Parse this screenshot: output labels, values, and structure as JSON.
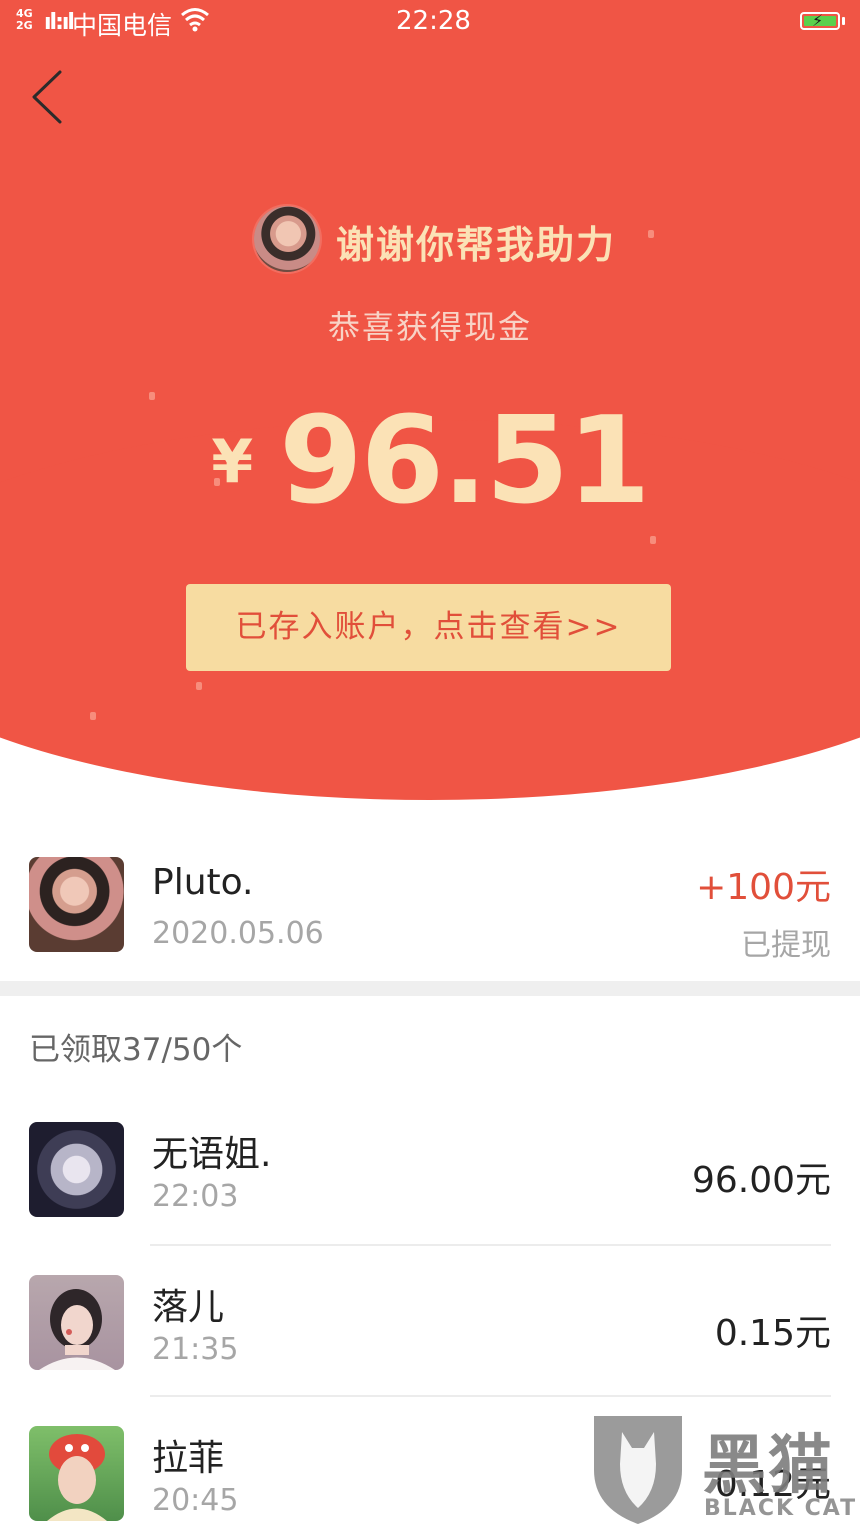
{
  "status_bar": {
    "network": "4G\n2G",
    "signal": "ıl ıl",
    "carrier": "中国电信",
    "time": "22:28"
  },
  "header": {
    "helper_title": "谢谢你帮我助力",
    "subtitle": "恭喜获得现金",
    "currency": "¥",
    "amount": "96.51",
    "cta_label": "已存入账户，点击查看>>"
  },
  "me": {
    "name": "Pluto.",
    "date": "2020.05.06",
    "amount": "+100元",
    "status": "已提现"
  },
  "claimed_summary": "已领取37/50个",
  "records": [
    {
      "name": "无语姐.",
      "time": "22:03",
      "amount": "96.00元"
    },
    {
      "name": "落儿",
      "time": "21:35",
      "amount": "0.15元"
    },
    {
      "name": "拉菲",
      "time": "20:45",
      "amount": "0.12元"
    }
  ],
  "watermark": {
    "cn": "黑猫",
    "en": "BLACK CAT"
  },
  "colors": {
    "header_red": "#f05545",
    "gold_text": "#fbe2b6",
    "button_bg": "#f7dca1",
    "accent_red": "#e14f3a"
  },
  "icons": [
    "back-arrow-icon",
    "wifi-icon",
    "battery-icon",
    "black-cat-shield-icon"
  ]
}
